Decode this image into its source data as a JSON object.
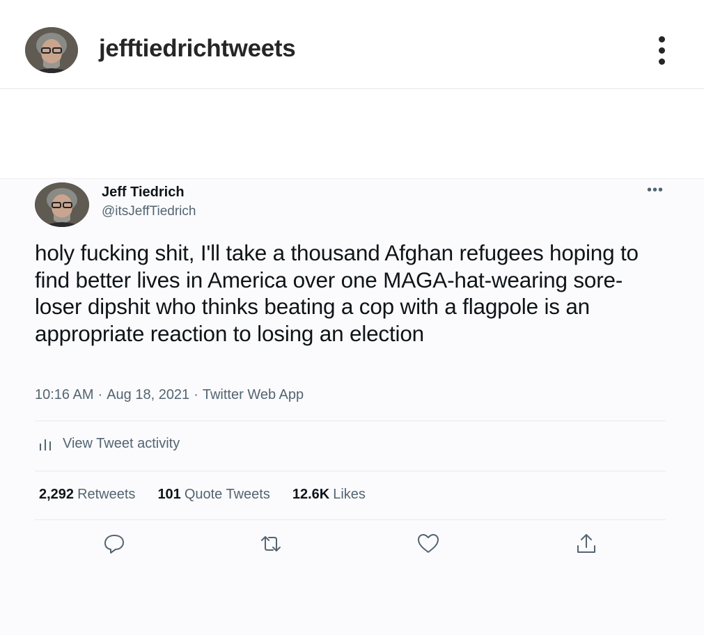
{
  "instagram": {
    "username": "jefftiedrichtweets",
    "more_icon": "vertical-ellipsis-icon"
  },
  "tweet": {
    "display_name": "Jeff Tiedrich",
    "handle": "@itsJeffTiedrich",
    "more_icon": "horizontal-ellipsis-icon",
    "text": "holy fucking shit, I'll take a thousand Afghan refugees hoping to find better lives in America over one MAGA-hat-wearing sore-loser dipshit who thinks beating a cop with a flagpole is an appropriate reaction to losing an election",
    "time": "10:16 AM",
    "date": "Aug 18, 2021",
    "source": "Twitter Web App",
    "separator": "·",
    "activity_label": "View Tweet activity",
    "stats": {
      "retweets_count": "2,292",
      "retweets_label": "Retweets",
      "quotes_count": "101",
      "quotes_label": "Quote Tweets",
      "likes_count": "12.6K",
      "likes_label": "Likes"
    },
    "actions": [
      "reply-icon",
      "retweet-icon",
      "like-icon",
      "share-icon"
    ]
  },
  "colors": {
    "text_primary": "#0f1419",
    "text_secondary": "#536471",
    "divider": "#e7e9ec",
    "card_bg": "#fbfbfd"
  }
}
